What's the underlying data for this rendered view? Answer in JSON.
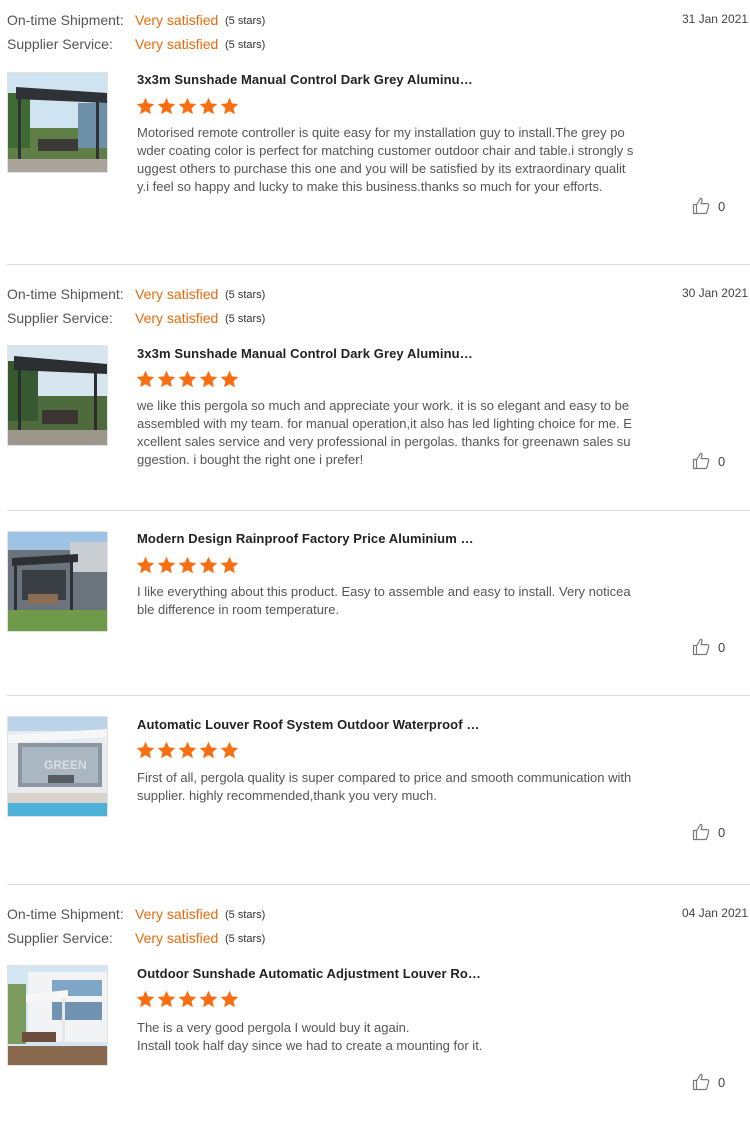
{
  "colors": {
    "accent": "#e56b0c",
    "star": "#f86f13",
    "divider": "#dcdcdc"
  },
  "icons": {
    "star": "star-icon",
    "like": "thumbs-up-icon"
  },
  "reviews": [
    {
      "ratings": [
        {
          "label": "On-time Shipment:",
          "value": "Very satisfied",
          "stars": "(5 stars)"
        },
        {
          "label": "Supplier Service:",
          "value": "Very satisfied",
          "stars": "(5 stars)"
        }
      ],
      "date": "31 Jan 2021",
      "product_title": "3x3m Sunshade Manual Control Dark Grey Aluminum ...",
      "star_rating": 5,
      "comment": "Motorised remote controller is quite easy for my installation guy to install.The grey powder coating color is perfect for matching customer outdoor chair and table.i strongly suggest others to purchase this one and you will be satisfied by its extraordinary quality.i feel so happy and lucky to make this business.thanks so much for your efforts.",
      "likes": "0"
    },
    {
      "ratings": [
        {
          "label": "On-time Shipment:",
          "value": "Very satisfied",
          "stars": "(5 stars)"
        },
        {
          "label": "Supplier Service:",
          "value": "Very satisfied",
          "stars": "(5 stars)"
        }
      ],
      "date": "30 Jan 2021",
      "product_title": "3x3m Sunshade Manual Control Dark Grey Aluminum ...",
      "star_rating": 5,
      "comment": "we like this pergola so much and appreciate your work. it is so elegant and easy to be assembled with my team. for manual operation,it also has led lighting choice for me. Excellent sales service and very professional in pergolas. thanks for greenawn sales suggestion. i bought the right one i prefer!",
      "likes": "0"
    },
    {
      "product_title": "Modern Design Rainproof Factory Price Aluminium Bi...",
      "star_rating": 5,
      "comment": "I like everything about this product. Easy to assemble and easy to install. Very noticeable difference in room temperature.",
      "likes": "0"
    },
    {
      "product_title": "Automatic Louver Roof System Outdoor Waterproof F...",
      "star_rating": 5,
      "image_watermark": "GREEN",
      "comment": "First of all, pergola quality is super compared to price and smooth communication with supplier. highly recommended,thank you very much.",
      "likes": "0"
    },
    {
      "ratings": [
        {
          "label": "On-time Shipment:",
          "value": "Very satisfied",
          "stars": "(5 stars)"
        },
        {
          "label": "Supplier Service:",
          "value": "Very satisfied",
          "stars": "(5 stars)"
        }
      ],
      "date": "04 Jan 2021",
      "product_title": "Outdoor Sunshade Automatic Adjustment Louver Roo...",
      "star_rating": 5,
      "comment": "The is a very good pergola  I would buy it again.\nInstall took half day since we had to create a mounting for it.",
      "likes": "0"
    }
  ]
}
